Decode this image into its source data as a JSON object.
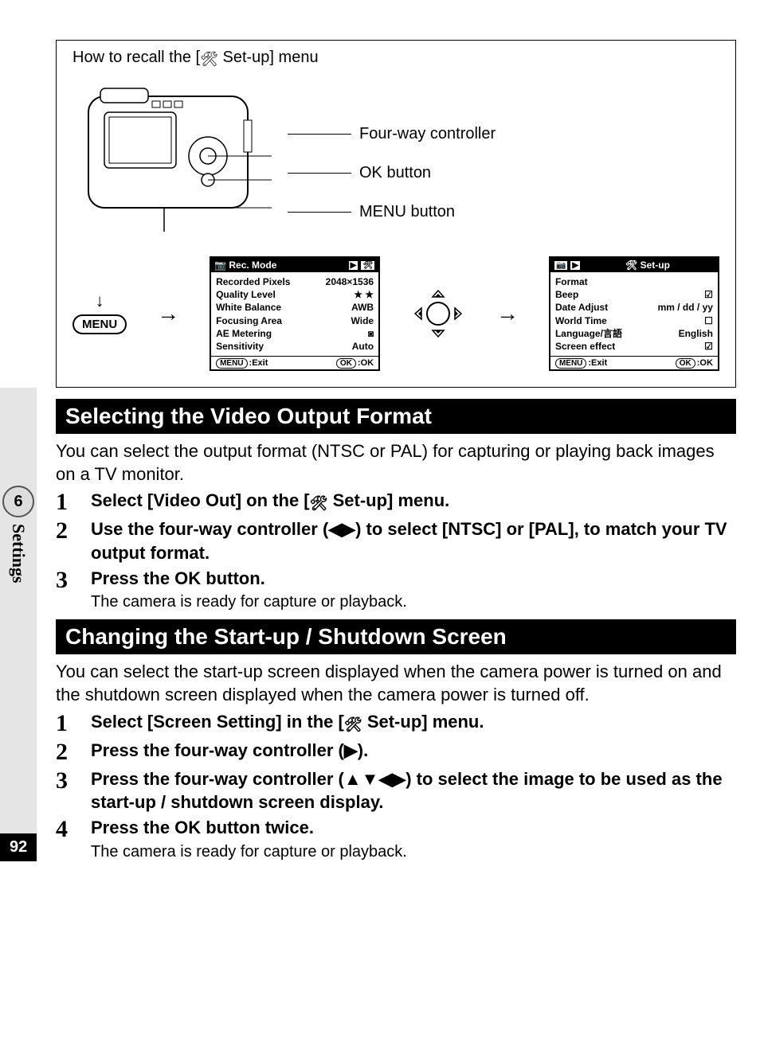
{
  "sidebar": {
    "chapter": "6",
    "label": "Settings"
  },
  "page_number": "92",
  "diagram": {
    "title_prefix": "How to recall the [",
    "title_suffix": " Set-up] menu",
    "callouts": [
      "Four-way controller",
      "OK button",
      "MENU button"
    ],
    "menu_label": "MENU"
  },
  "lcd_left": {
    "header_icon": "●",
    "header_title": "Rec. Mode",
    "rows": [
      {
        "label": "Recorded Pixels",
        "value": "2048×1536"
      },
      {
        "label": "Quality Level",
        "value": "★ ★"
      },
      {
        "label": "White Balance",
        "value": "AWB"
      },
      {
        "label": "Focusing Area",
        "value": "Wide"
      },
      {
        "label": "AE Metering",
        "value": "◙"
      },
      {
        "label": "Sensitivity",
        "value": "Auto"
      }
    ],
    "footer_left_pill": "MENU",
    "footer_left_text": ":Exit",
    "footer_right_pill": "OK",
    "footer_right_text": ":OK"
  },
  "lcd_right": {
    "header_title": "Set-up",
    "rows": [
      {
        "label": "Format",
        "value": ""
      },
      {
        "label": "Beep",
        "value": "☑"
      },
      {
        "label": "Date Adjust",
        "value": "mm / dd / yy"
      },
      {
        "label": "World Time",
        "value": "☐"
      },
      {
        "label": "Language/言語",
        "value": "English"
      },
      {
        "label": "Screen effect",
        "value": "☑"
      }
    ],
    "footer_left_pill": "MENU",
    "footer_left_text": ":Exit",
    "footer_right_pill": "OK",
    "footer_right_text": ":OK"
  },
  "section1": {
    "heading": "Selecting the Video Output Format",
    "intro": "You can select the output format (NTSC or PAL) for capturing or playing back images on a TV monitor.",
    "steps": [
      {
        "main_pre": "Select [Video Out] on the [",
        "main_post": " Set-up] menu."
      },
      {
        "main": "Use the four-way controller (◀▶) to select [NTSC] or [PAL], to match your TV output format."
      },
      {
        "main": "Press the OK button.",
        "sub": "The camera is ready for capture or playback."
      }
    ]
  },
  "section2": {
    "heading": "Changing the Start-up / Shutdown Screen",
    "intro": "You can select the start-up screen displayed when the camera power is turned on and the shutdown screen displayed when the camera power is turned off.",
    "steps": [
      {
        "main_pre": "Select [Screen Setting] in the [",
        "main_post": " Set-up] menu."
      },
      {
        "main": "Press the four-way controller (▶)."
      },
      {
        "main": "Press the four-way controller (▲▼◀▶) to select the image to be used as the start-up / shutdown screen display."
      },
      {
        "main": "Press the OK button twice.",
        "sub": "The camera is ready for capture or playback."
      }
    ]
  }
}
